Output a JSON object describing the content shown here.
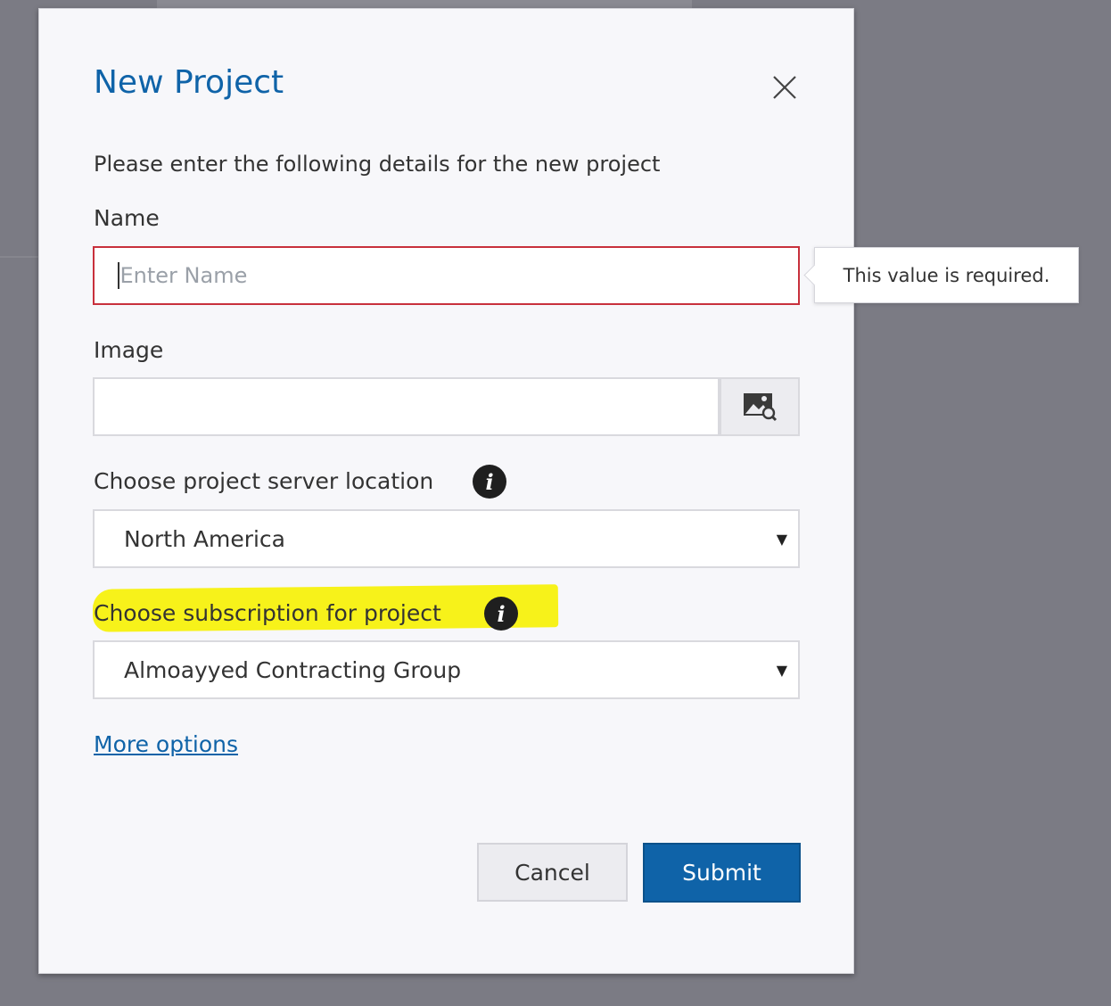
{
  "dialog": {
    "title": "New Project",
    "intro": "Please enter the following details for the new project"
  },
  "fields": {
    "name": {
      "label": "Name",
      "placeholder": "Enter Name",
      "value": ""
    },
    "image": {
      "label": "Image",
      "value": "",
      "browse_icon": "image-search-icon"
    },
    "location": {
      "label": "Choose project server location",
      "selected": "North America",
      "info_icon": "info-icon"
    },
    "subscription": {
      "label": "Choose subscription for project",
      "selected": "Almoayyed Contracting Group",
      "info_icon": "info-icon",
      "highlight_color": "#f7f21a"
    }
  },
  "links": {
    "more_options": "More options"
  },
  "buttons": {
    "cancel": "Cancel",
    "submit": "Submit"
  },
  "validation": {
    "tooltip": "This value is required."
  },
  "colors": {
    "accent": "#0f63a8",
    "error_border": "#c8303c",
    "overlay": "#7b7b84"
  }
}
